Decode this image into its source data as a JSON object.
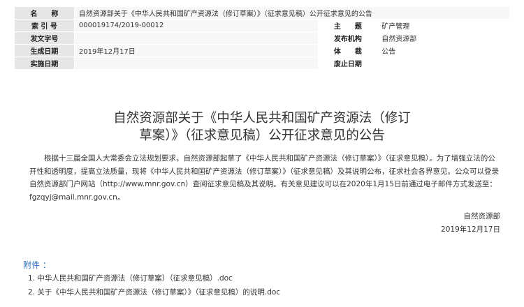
{
  "meta": {
    "row1": {
      "label": "名　　称",
      "value": "自然资源部关于《中华人民共和国矿产资源法（修订草案）》（征求意见稿）公开征求意见的公告"
    },
    "row2": {
      "label": "索 引 号",
      "value": "000019174/2019-00012",
      "label_r": "主　　题",
      "value_r": "矿产管理"
    },
    "row3": {
      "label": "发文字号",
      "value": "",
      "label_r": "发布机构",
      "value_r": "自然资源部"
    },
    "row4": {
      "label": "生成日期",
      "value": "2019年12月17日",
      "label_r": "体　　裁",
      "value_r": "公告"
    },
    "row5": {
      "label": "实施日期",
      "value": "",
      "label_r": "废止日期",
      "value_r": ""
    }
  },
  "title": {
    "line1": "自然资源部关于《中华人民共和国矿产资源法（修订",
    "line2": "草案）》（征求意见稿）公开征求意见的公告"
  },
  "body": {
    "paragraph": "根据十三届全国人大常委会立法规划要求，自然资源部起草了《中华人民共和国矿产资源法（修订草案）》（征求意见稿）。为了增强立法的公开性和透明度，提高立法质量，现将《中华人民共和国矿产资源法（修订草案）》（征求意见稿）及其说明公布，征求社会各界意见。公众可以登录自然资源部门户网站（http://www.mnr.gov.cn）查阅征求意见稿及其说明。有关意见建议可以在2020年1月15日前通过电子邮件方式发送至：fgzqyj@mail.mnr.gov.cn。"
  },
  "signature": {
    "org": "自然资源部",
    "date": "2019年12月17日"
  },
  "attachments": {
    "label": "附件 ：",
    "items": [
      "1. 中华人民共和国矿产资源法（修订草案）（征求意见稿）.doc",
      "2. 关于《中华人民共和国矿产资源法（修订草案）》（征求意见稿）的说明.doc"
    ]
  },
  "colors": {
    "label_bg": "#e6e6e6",
    "value_bg": "#f7f7f7",
    "link": "#2a6ebd"
  }
}
